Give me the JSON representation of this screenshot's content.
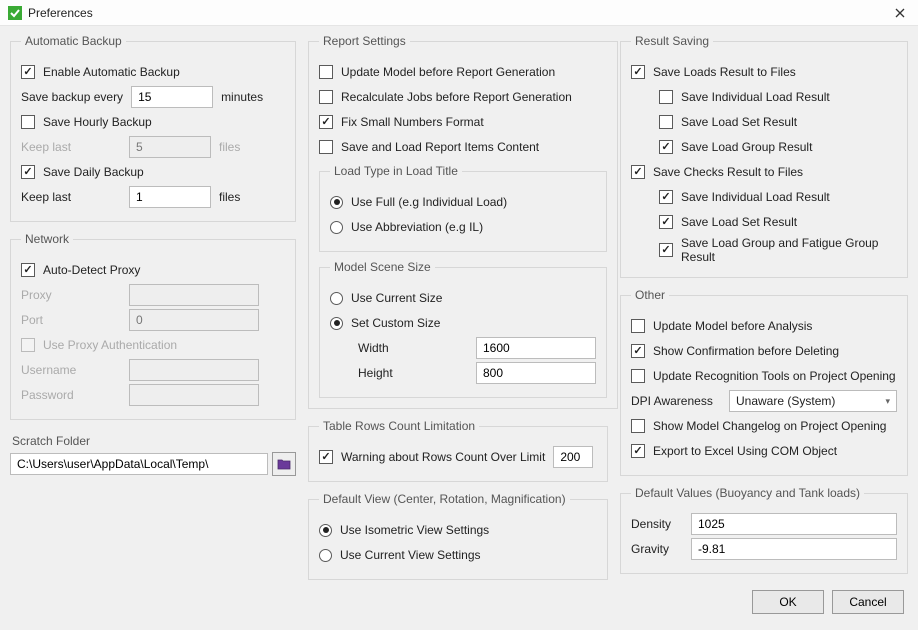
{
  "title": "Preferences",
  "autoBackup": {
    "legend": "Automatic Backup",
    "enable": "Enable Automatic Backup",
    "saveEvery": "Save backup every",
    "saveEveryVal": "15",
    "minutes": "minutes",
    "hourly": "Save Hourly Backup",
    "keepLast": "Keep last",
    "hourlyVal": "5",
    "files": "files",
    "daily": "Save Daily Backup",
    "dailyVal": "1"
  },
  "network": {
    "legend": "Network",
    "autoDetect": "Auto-Detect Proxy",
    "proxy": "Proxy",
    "port": "Port",
    "portVal": "0",
    "useProxyAuth": "Use Proxy Authentication",
    "username": "Username",
    "password": "Password"
  },
  "scratch": {
    "legend": "Scratch Folder",
    "path": "C:\\Users\\user\\AppData\\Local\\Temp\\"
  },
  "report": {
    "legend": "Report Settings",
    "updateModel": "Update Model before Report Generation",
    "recalc": "Recalculate Jobs before Report Generation",
    "fixSmall": "Fix Small Numbers Format",
    "saveLoad": "Save and Load Report Items Content",
    "loadType": {
      "legend": "Load Type in Load Title",
      "full": "Use Full (e.g Individual Load)",
      "abbrev": "Use Abbreviation (e.g IL)"
    },
    "scene": {
      "legend": "Model Scene Size",
      "current": "Use Current Size",
      "custom": "Set Custom Size",
      "width": "Width",
      "widthVal": "1600",
      "height": "Height",
      "heightVal": "800"
    }
  },
  "tableRows": {
    "legend": "Table Rows Count Limitation",
    "warn": "Warning about Rows Count Over Limit",
    "val": "200"
  },
  "defaultView": {
    "legend": "Default View (Center, Rotation, Magnification)",
    "iso": "Use Isometric View Settings",
    "current": "Use Current View Settings"
  },
  "resultSaving": {
    "legend": "Result Saving",
    "saveLoads": "Save Loads Result to Files",
    "indivLoad": "Save Individual Load Result",
    "loadSet": "Save Load Set Result",
    "loadGroup": "Save Load Group Result",
    "saveChecks": "Save Checks Result to Files",
    "indivLoad2": "Save Individual Load Result",
    "loadSet2": "Save Load Set Result",
    "loadGroupFatigue": "Save Load Group and Fatigue Group Result"
  },
  "other": {
    "legend": "Other",
    "updateModel": "Update Model before Analysis",
    "confirmDel": "Show Confirmation before Deleting",
    "updateRecog": "Update Recognition Tools on Project Opening",
    "dpi": "DPI Awareness",
    "dpiVal": "Unaware (System)",
    "changelog": "Show Model Changelog on Project Opening",
    "excel": "Export to Excel Using COM Object"
  },
  "defaults": {
    "legend": "Default Values (Buoyancy and Tank loads)",
    "density": "Density",
    "densityVal": "1025",
    "gravity": "Gravity",
    "gravityVal": "-9.81"
  },
  "buttons": {
    "ok": "OK",
    "cancel": "Cancel"
  }
}
